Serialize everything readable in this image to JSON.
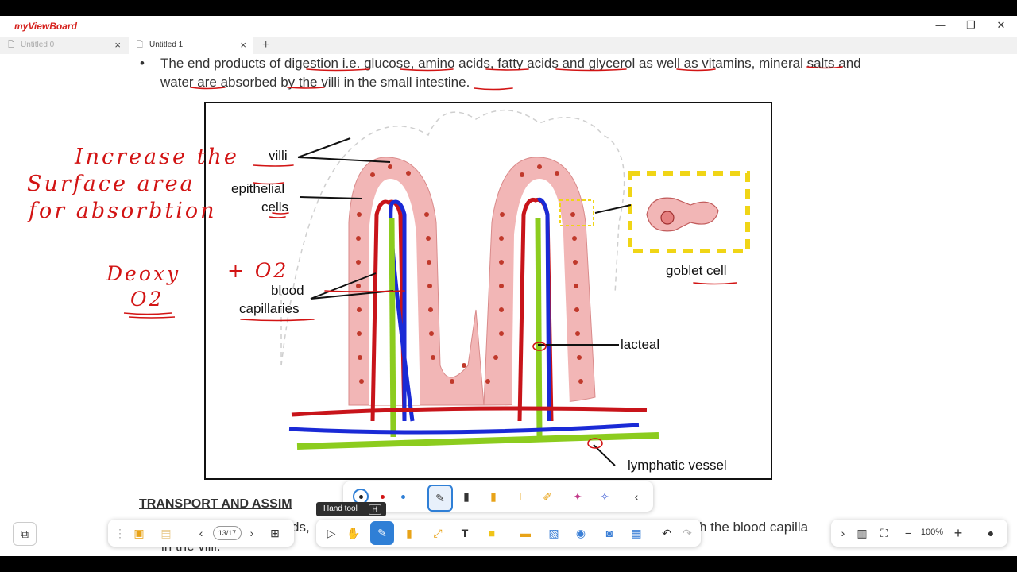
{
  "app": {
    "logo": "myViewBoard",
    "minimize": "—",
    "restore": "❐",
    "close": "✕"
  },
  "tabs": [
    {
      "label": "Untitled 0",
      "active": false
    },
    {
      "label": "Untitled 1",
      "active": true
    }
  ],
  "slide": {
    "bullet": "•",
    "text": "The end products of digestion i.e. glucose, amino acids, fatty acids and glycerol as well as vitamins, mineral salts and water are absorbed by the villi in the small intestine.",
    "heading": "TRANSPORT AND ASSIM",
    "para2_start": "ds,",
    "para2_end": "h the blood capilla",
    "para2_line2": "in the villi."
  },
  "diagram": {
    "labels": {
      "villi": "villi",
      "epithelial": "epithelial",
      "cells": "cells",
      "blood": "blood",
      "capillaries": "capillaries",
      "goblet": "goblet cell",
      "lacteal": "lacteal",
      "lymphatic": "lymphatic vessel"
    }
  },
  "annotations": {
    "line1": "Increase the",
    "line2": "Surface area",
    "line3": "for absorbtion",
    "deoxy": "Deoxy",
    "o2a": "O2",
    "plus_o2": "+ O2"
  },
  "pen_toolbar": {
    "colors": [
      "#222222",
      "#d21414",
      "#2f7fd6"
    ],
    "accent": "#2f7fd6"
  },
  "bottom": {
    "page": "13/17",
    "tooltip": "Hand tool",
    "tooltip_key": "H",
    "zoom": "100%"
  }
}
